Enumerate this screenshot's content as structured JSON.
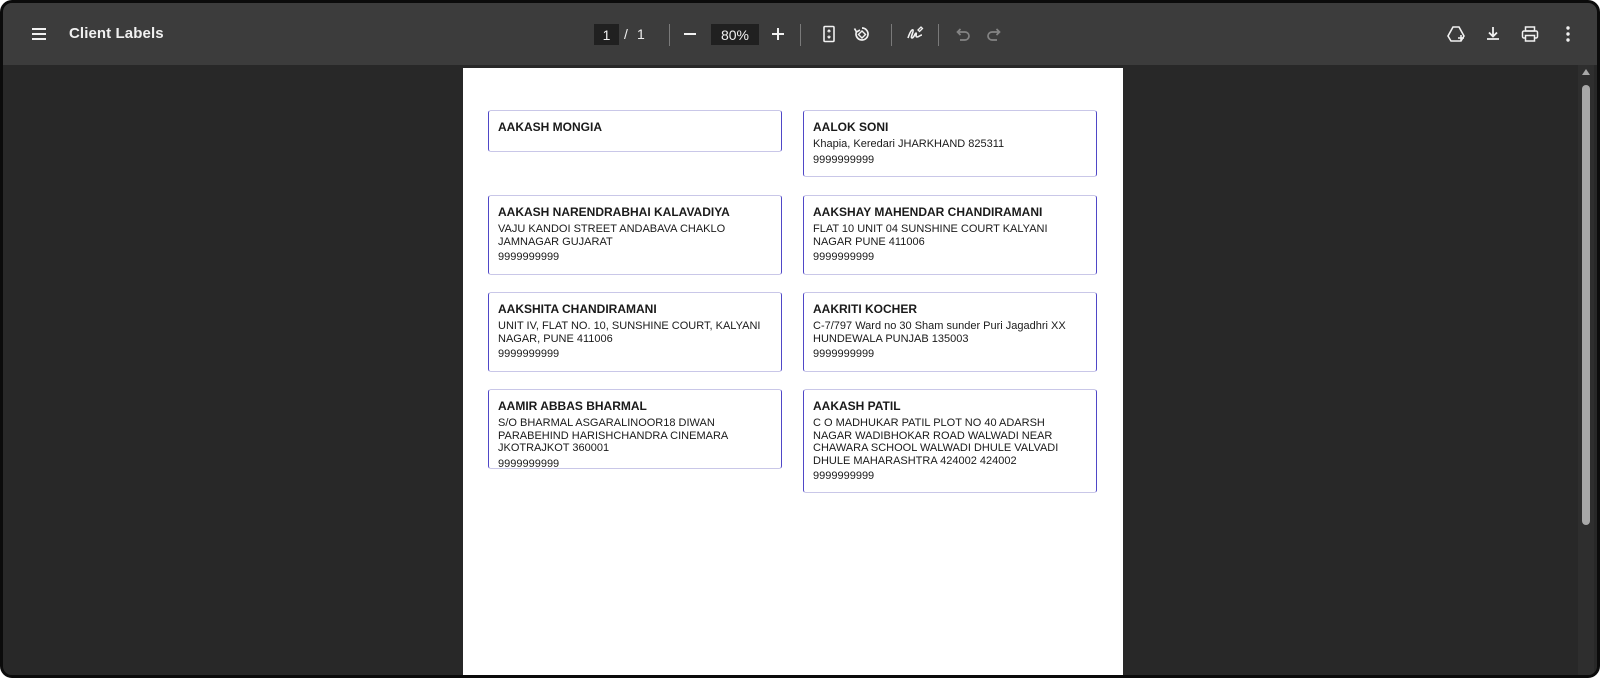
{
  "toolbar": {
    "title": "Client Labels",
    "page_current": "1",
    "page_separator": "/",
    "page_total": "1",
    "zoom": "80%",
    "icons": [
      "menu-icon",
      "zoom-out-icon",
      "zoom-in-icon",
      "fit-page-icon",
      "rotate-icon",
      "annotate-icon",
      "undo-icon",
      "redo-icon",
      "save-to-drive-icon",
      "download-icon",
      "print-icon",
      "more-icon"
    ]
  },
  "labels": [
    {
      "name": "AAKASH MONGIA",
      "address": "",
      "phone": ""
    },
    {
      "name": "AALOK SONI",
      "address": "Khapia, Keredari JHARKHAND 825311",
      "phone": "9999999999"
    },
    {
      "name": "AAKASH NARENDRABHAI KALAVADIYA",
      "address": "VAJU KANDOI STREET ANDABAVA CHAKLO JAMNAGAR GUJARAT",
      "phone": "9999999999"
    },
    {
      "name": "AAKSHAY MAHENDAR CHANDIRAMANI",
      "address": "FLAT 10 UNIT 04 SUNSHINE COURT KALYANI NAGAR PUNE 411006",
      "phone": "9999999999"
    },
    {
      "name": "AAKSHITA CHANDIRAMANI",
      "address": "UNIT IV, FLAT NO. 10, SUNSHINE COURT, KALYANI NAGAR, PUNE 411006",
      "phone": "9999999999"
    },
    {
      "name": "AAKRITI KOCHER",
      "address": "C-7/797 Ward no 30 Sham sunder Puri Jagadhri XX HUNDEWALA PUNJAB 135003",
      "phone": "9999999999"
    },
    {
      "name": "AAMIR ABBAS BHARMAL",
      "address": "S/O BHARMAL ASGARALINOOR18 DIWAN PARABEHIND HARISHCHANDRA CINEMARA JKOTRAJKOT 360001",
      "phone": "9999999999"
    },
    {
      "name": "AAKASH PATIL",
      "address": "C O MADHUKAR PATIL PLOT NO 40 ADARSH NAGAR WADIBHOKAR ROAD WALWADI NEAR CHAWARA SCHOOL WALWADI DHULE VALVADI DHULE MAHARASHTRA 424002 424002",
      "phone": "9999999999"
    }
  ]
}
